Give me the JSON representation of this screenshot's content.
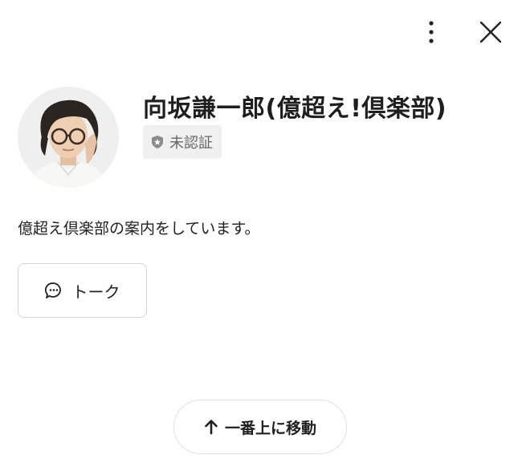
{
  "profile": {
    "name": "向坂謙一郎(億超え!倶楽部)",
    "verification_status": "未認証",
    "description": "億超え倶楽部の案内をしています。"
  },
  "actions": {
    "talk_label": "トーク",
    "scroll_top_label": "一番上に移動"
  },
  "icons": {
    "menu": "more-vertical-icon",
    "close": "close-icon",
    "badge": "shield-star-icon",
    "talk": "chat-bubble-icon",
    "scroll_top": "arrow-up-icon"
  }
}
